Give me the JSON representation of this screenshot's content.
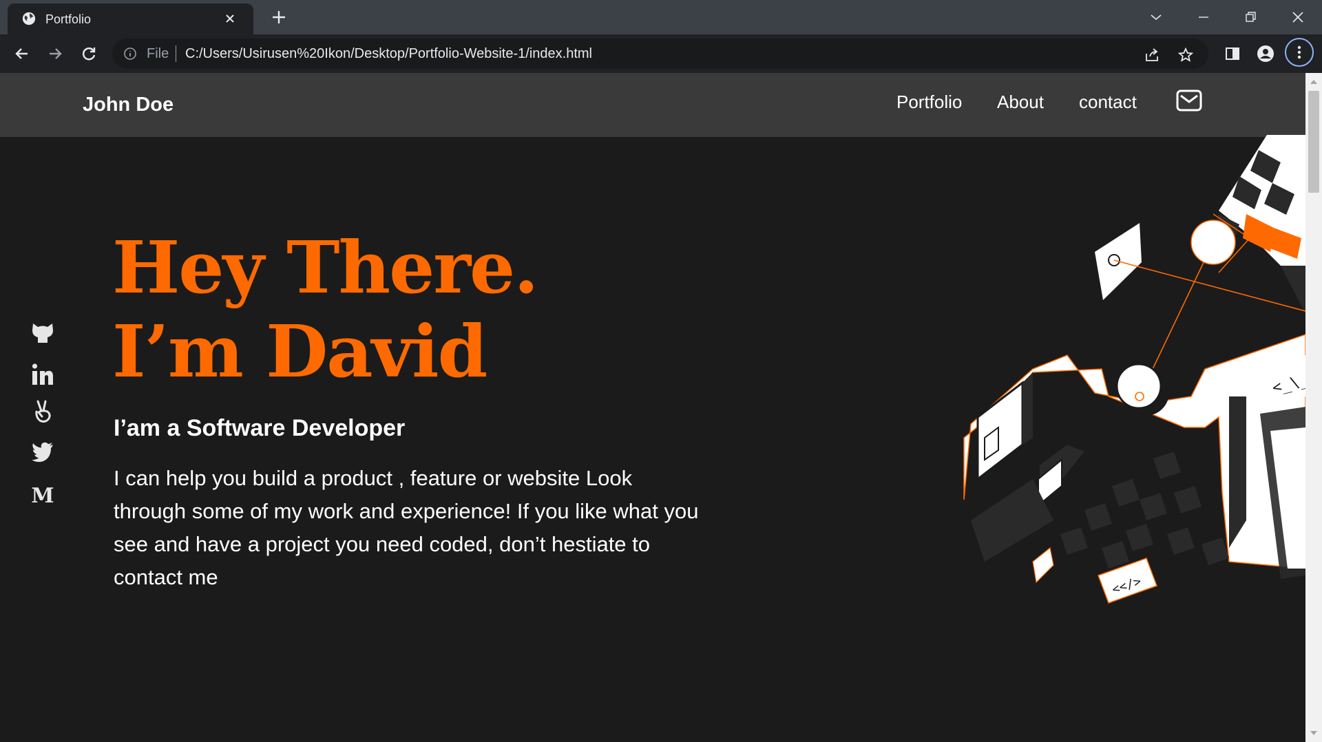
{
  "browser": {
    "tab_title": "Portfolio",
    "scheme_label": "File",
    "url": "C:/Users/Usirusen%20Ikon/Desktop/Portfolio-Website-1/index.html",
    "icons": [
      "globe-icon",
      "close-icon",
      "plus-icon",
      "chevron-down-icon",
      "minimize-icon",
      "restore-icon",
      "close-window-icon",
      "back-icon",
      "forward-icon",
      "reload-icon",
      "info-icon",
      "share-icon",
      "star-icon",
      "side-panel-icon",
      "profile-icon",
      "menu-icon"
    ]
  },
  "site": {
    "brand": "John Doe",
    "nav": [
      "Portfolio",
      "About",
      "contact"
    ],
    "accent_color": "#ff6a00",
    "socials": [
      "github-icon",
      "linkedin-icon",
      "angellist-icon",
      "twitter-icon",
      "medium-icon"
    ],
    "hero": {
      "line1": "Hey There.",
      "line2": "I’m David",
      "subtitle": "I’am a Software Developer",
      "body": "I can help you build a product , feature or website Look through some of my work and experience! If you like what you see and have a project you need coded, don’t hestiate to contact me"
    },
    "illustration_labels": [
      "<_\\_",
      "<</>"
    ]
  }
}
